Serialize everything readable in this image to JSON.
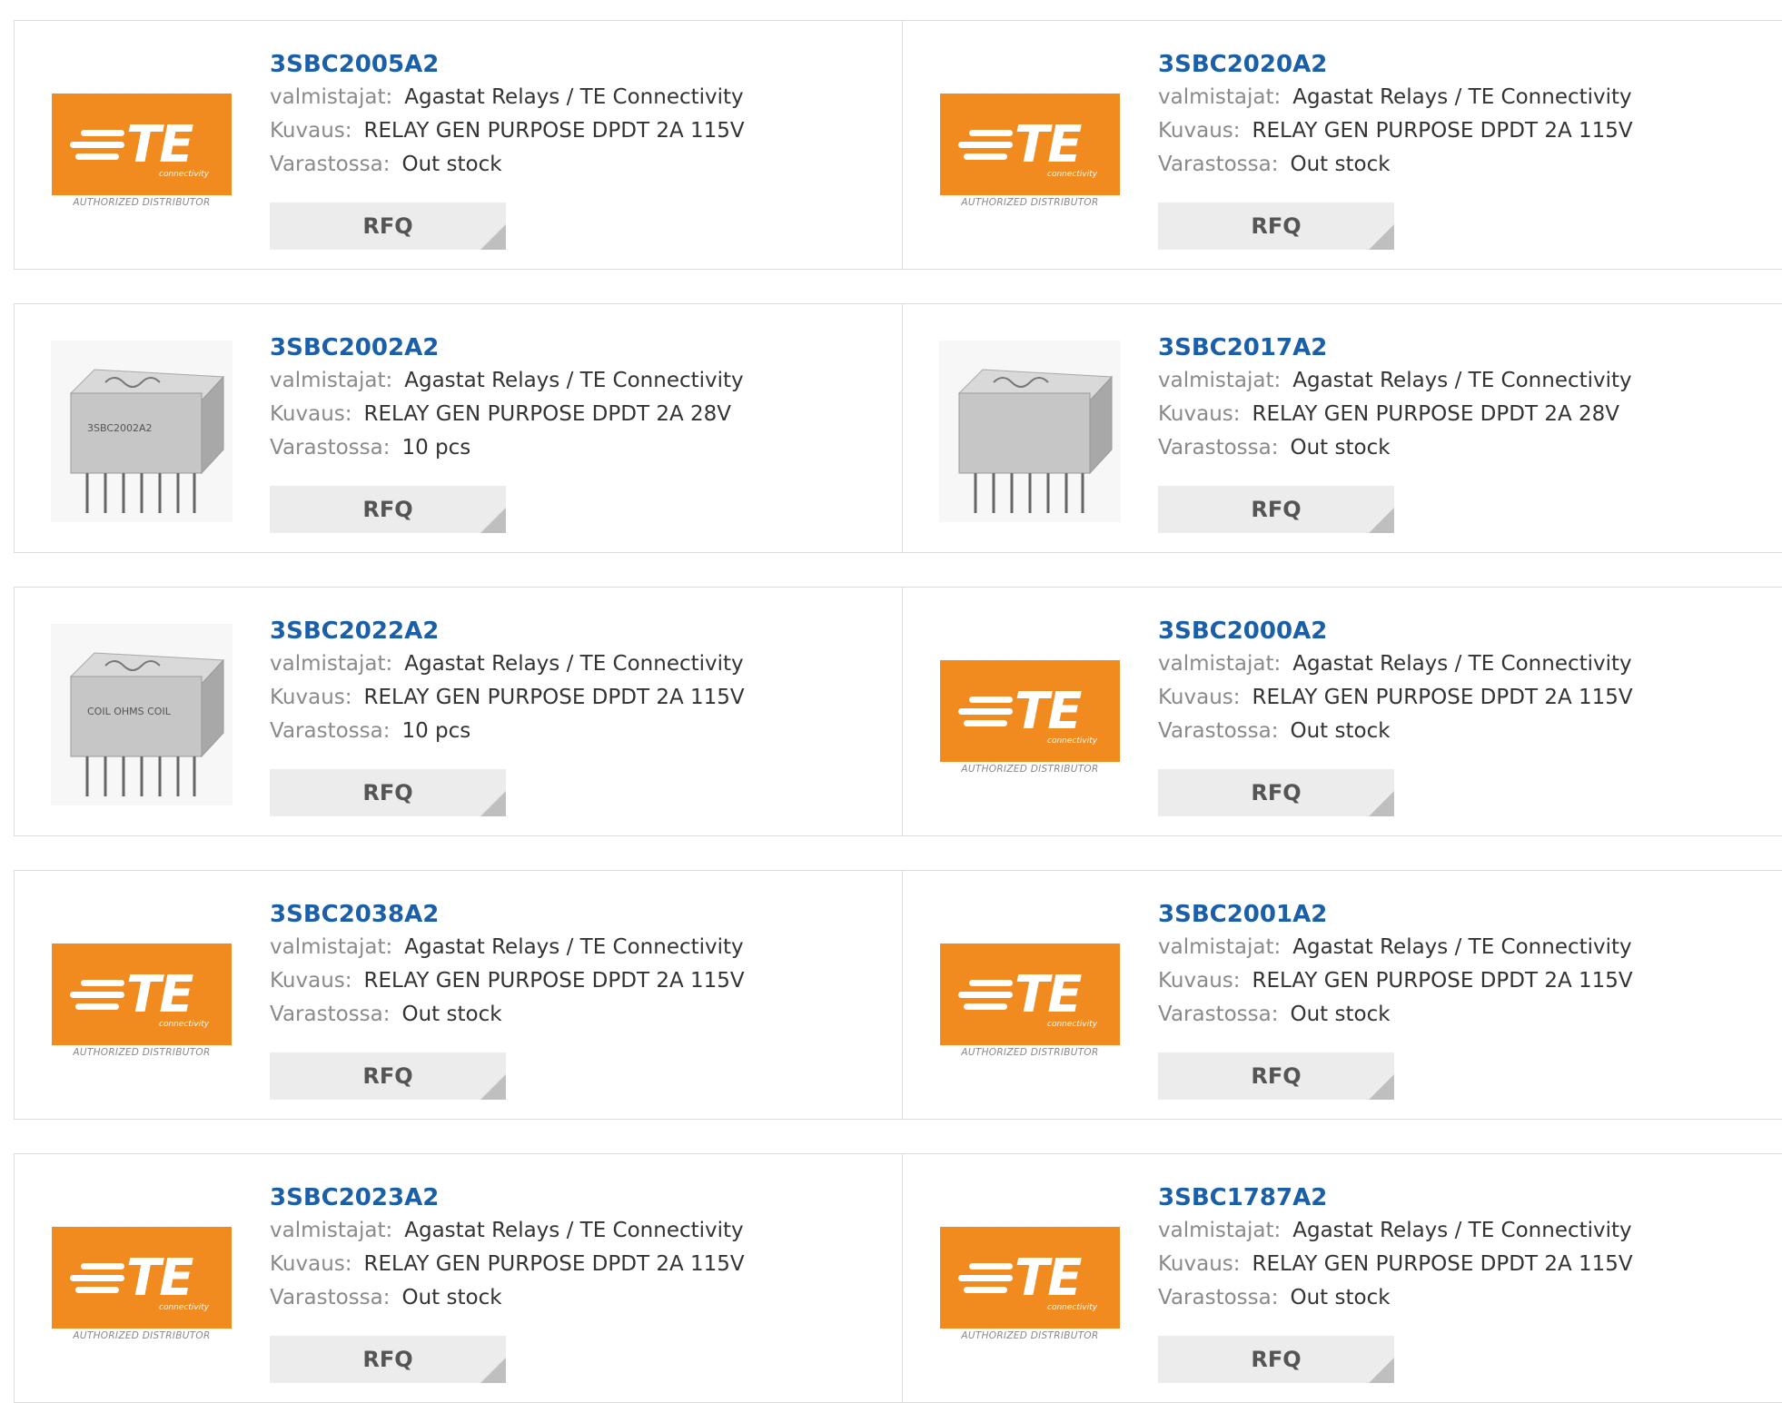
{
  "labels": {
    "manufacturer": "valmistajat:",
    "description": "Kuvaus:",
    "stock": "Varastossa:",
    "rfq": "RFQ"
  },
  "logo": {
    "brand": "TE",
    "tagline": "connectivity",
    "caption": "AUTHORIZED DISTRIBUTOR",
    "color": "#f18a1f"
  },
  "colors": {
    "title": "#1a5fa8",
    "label": "#8a8a8a",
    "value": "#333333",
    "rfq_bg": "#ececec"
  },
  "products": [
    {
      "part": "3SBC2005A2",
      "manufacturer": "Agastat Relays / TE Connectivity",
      "description": "RELAY GEN PURPOSE DPDT 2A 115V",
      "stock": "Out stock",
      "image": "te-logo"
    },
    {
      "part": "3SBC2020A2",
      "manufacturer": "Agastat Relays / TE Connectivity",
      "description": "RELAY GEN PURPOSE DPDT 2A 115V",
      "stock": "Out stock",
      "image": "te-logo"
    },
    {
      "part": "3SBC2002A2",
      "manufacturer": "Agastat Relays / TE Connectivity",
      "description": "RELAY GEN PURPOSE DPDT 2A 28V",
      "stock": "10 pcs",
      "image": "relay-photo",
      "print": "3SBC2002A2"
    },
    {
      "part": "3SBC2017A2",
      "manufacturer": "Agastat Relays / TE Connectivity",
      "description": "RELAY GEN PURPOSE DPDT 2A 28V",
      "stock": "Out stock",
      "image": "relay-photo",
      "print": ""
    },
    {
      "part": "3SBC2022A2",
      "manufacturer": "Agastat Relays / TE Connectivity",
      "description": "RELAY GEN PURPOSE DPDT 2A 115V",
      "stock": "10 pcs",
      "image": "relay-photo",
      "print": "COIL OHMS COIL"
    },
    {
      "part": "3SBC2000A2",
      "manufacturer": "Agastat Relays / TE Connectivity",
      "description": "RELAY GEN PURPOSE DPDT 2A 115V",
      "stock": "Out stock",
      "image": "te-logo"
    },
    {
      "part": "3SBC2038A2",
      "manufacturer": "Agastat Relays / TE Connectivity",
      "description": "RELAY GEN PURPOSE DPDT 2A 115V",
      "stock": "Out stock",
      "image": "te-logo"
    },
    {
      "part": "3SBC2001A2",
      "manufacturer": "Agastat Relays / TE Connectivity",
      "description": "RELAY GEN PURPOSE DPDT 2A 115V",
      "stock": "Out stock",
      "image": "te-logo"
    },
    {
      "part": "3SBC2023A2",
      "manufacturer": "Agastat Relays / TE Connectivity",
      "description": "RELAY GEN PURPOSE DPDT 2A 115V",
      "stock": "Out stock",
      "image": "te-logo"
    },
    {
      "part": "3SBC1787A2",
      "manufacturer": "Agastat Relays / TE Connectivity",
      "description": "RELAY GEN PURPOSE DPDT 2A 115V",
      "stock": "Out stock",
      "image": "te-logo"
    }
  ]
}
